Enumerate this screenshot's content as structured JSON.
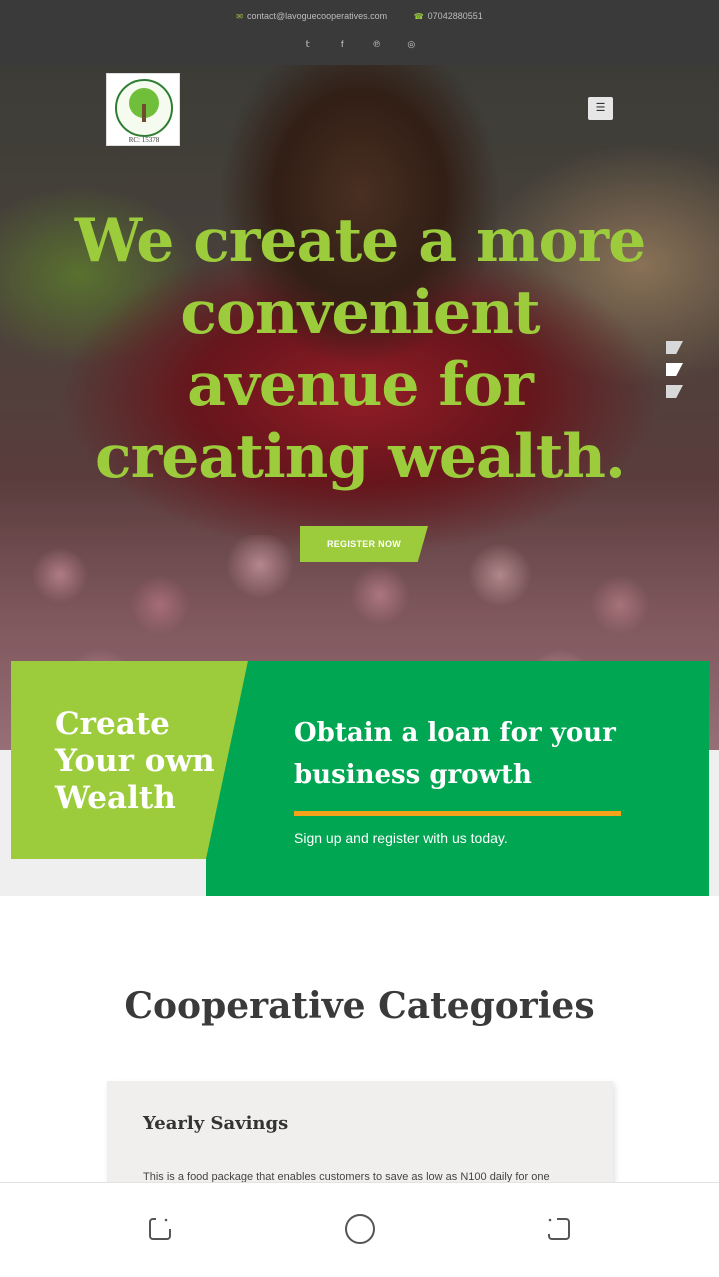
{
  "topbar": {
    "email": "contact@lavoguecooperatives.com",
    "phone": "07042880551",
    "email_icon": "envelope-icon",
    "phone_icon": "phone-icon",
    "social": [
      "twitter-icon",
      "facebook-icon",
      "pinterest-icon",
      "instagram-icon"
    ]
  },
  "logo": {
    "rc_text": "RC: 15378"
  },
  "hero": {
    "headline": "We create a more convenient avenue for creating wealth.",
    "register_label": "REGISTER NOW",
    "slides_count": 3,
    "active_slide": 2
  },
  "promo": {
    "create_text": "Create Your own Wealth",
    "loan_title": "Obtain a loan for your business growth",
    "signup_text": "Sign up and register with us today."
  },
  "categories": {
    "title": "Cooperative Categories",
    "card": {
      "title": "Yearly Savings",
      "text": "This is a food package that enables customers to save as low as N100 daily for one"
    }
  },
  "colors": {
    "brand_green": "#00a651",
    "lime": "#9ccc3c",
    "orange": "#f7a21b",
    "topbar": "#3a3a3a"
  }
}
